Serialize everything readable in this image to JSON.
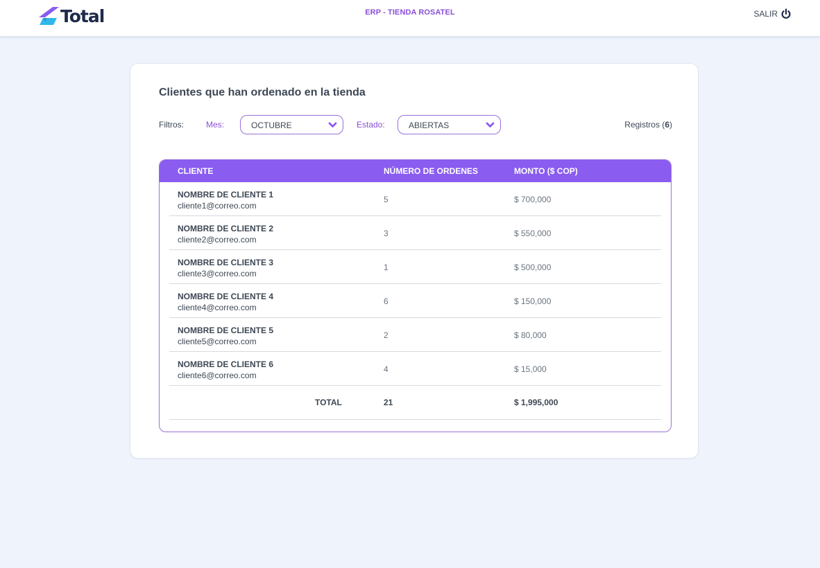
{
  "header": {
    "logo_text": "Total",
    "app_title": "ERP - TIENDA ROSATEL",
    "logout_label": "SALIR",
    "logout_icon": "power-icon",
    "logo_icon": "total-logo-icon"
  },
  "colors": {
    "accent": "#8a5cf0",
    "accent_text": "#8a4fd6",
    "background": "#eef3fc",
    "text": "#3d4754"
  },
  "main": {
    "title": "Clientes que han ordenado en la tienda",
    "filters": {
      "label": "Filtros:",
      "month_label": "Mes:",
      "month_value": "OCTUBRE",
      "state_label": "Estado:",
      "state_value": "ABIERTAS",
      "dropdown_icon": "chevron-down-icon"
    },
    "records": {
      "label": "Registros",
      "count": "6"
    },
    "table": {
      "columns": [
        "CLIENTE",
        "NÚMERO DE ORDENES",
        "MONTO ($ COP)"
      ],
      "rows": [
        {
          "name": "NOMBRE DE CLIENTE 1",
          "email": "cliente1@correo.com",
          "orders": "5",
          "amount": "$ 700,000"
        },
        {
          "name": "NOMBRE DE CLIENTE 2",
          "email": "cliente2@correo.com",
          "orders": "3",
          "amount": "$ 550,000"
        },
        {
          "name": "NOMBRE DE CLIENTE 3",
          "email": "cliente3@correo.com",
          "orders": "1",
          "amount": "$ 500,000"
        },
        {
          "name": "NOMBRE DE CLIENTE 4",
          "email": "cliente4@correo.com",
          "orders": "6",
          "amount": "$ 150,000"
        },
        {
          "name": "NOMBRE DE CLIENTE 5",
          "email": "cliente5@correo.com",
          "orders": "2",
          "amount": "$ 80,000"
        },
        {
          "name": "NOMBRE DE CLIENTE 6",
          "email": "cliente6@correo.com",
          "orders": "4",
          "amount": "$ 15,000"
        }
      ],
      "total": {
        "label": "TOTAL",
        "orders": "21",
        "amount": "$ 1,995,000"
      }
    }
  }
}
